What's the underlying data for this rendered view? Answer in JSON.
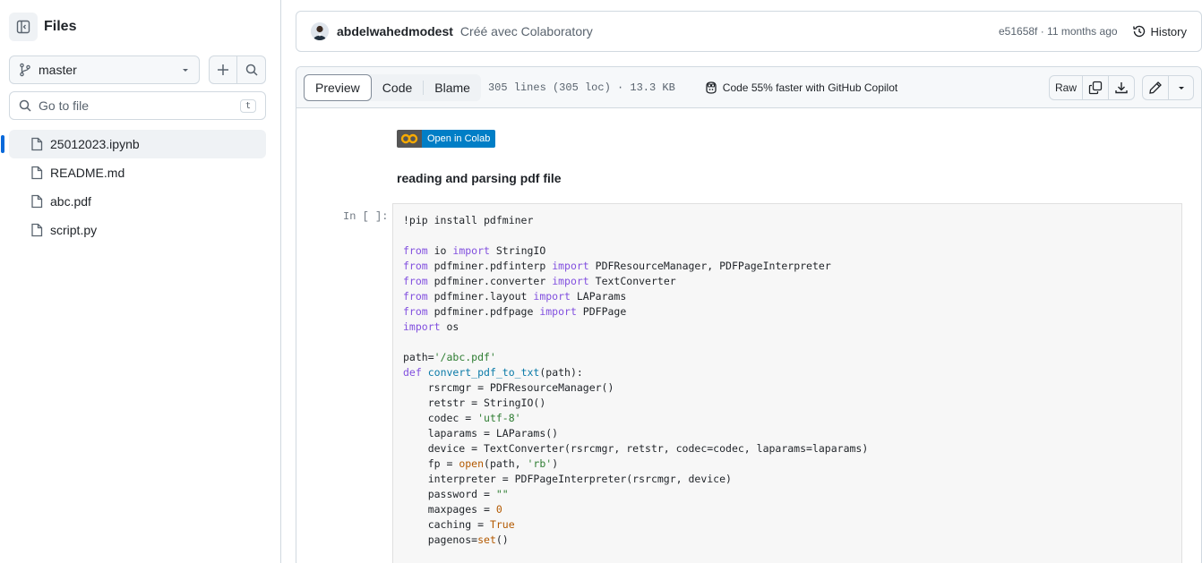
{
  "sidebar": {
    "title": "Files",
    "branch": "master",
    "search_placeholder": "Go to file",
    "search_shortcut": "t",
    "files": [
      "25012023.ipynb",
      "README.md",
      "abc.pdf",
      "script.py"
    ]
  },
  "commit": {
    "author": "abdelwahedmodest",
    "message": "Créé avec Colaboratory",
    "sha_time": "e51658f · 11 months ago",
    "history_label": "History"
  },
  "toolbar": {
    "tabs": [
      "Preview",
      "Code",
      "Blame"
    ],
    "active_tab": "Preview",
    "file_meta": "305 lines (305 loc) · 13.3 KB",
    "copilot_text": "Code 55% faster with GitHub Copilot",
    "raw_label": "Raw"
  },
  "notebook": {
    "badge_text": "Open in Colab",
    "markdown_heading": "reading and parsing pdf file",
    "prompt": "In [ ]:",
    "code": [
      "!pip install pdfminer",
      "",
      "from io import StringIO",
      "from pdfminer.pdfinterp import PDFResourceManager, PDFPageInterpreter",
      "from pdfminer.converter import TextConverter",
      "from pdfminer.layout import LAParams",
      "from pdfminer.pdfpage import PDFPage",
      "import os",
      "",
      "path='/abc.pdf'",
      "def convert_pdf_to_txt(path):",
      "    rsrcmgr = PDFResourceManager()",
      "    retstr = StringIO()",
      "    codec = 'utf-8'",
      "    laparams = LAParams()",
      "    device = TextConverter(rsrcmgr, retstr, codec=codec, laparams=laparams)",
      "    fp = open(path, 'rb')",
      "    interpreter = PDFPageInterpreter(rsrcmgr, device)",
      "    password = \"\"",
      "    maxpages = 0",
      "    caching = True",
      "    pagenos=set()"
    ]
  },
  "colors": {
    "accent": "#0969da",
    "colab_badge": "#007ec6",
    "keyword": "#8250df",
    "string": "#2e7d32"
  }
}
